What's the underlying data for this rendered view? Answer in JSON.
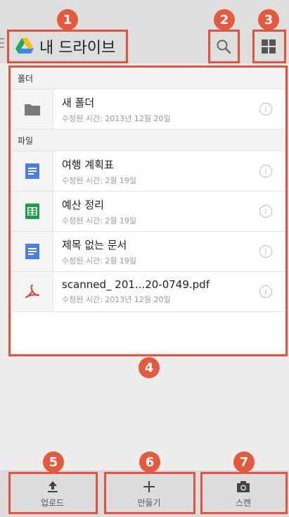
{
  "header": {
    "title": "내 드라이브"
  },
  "list": {
    "sections": [
      {
        "title": "폴더",
        "items": [
          {
            "name": "새 폴더",
            "meta": "수정된 시간: 2013년 12월 20일",
            "icon": "folder-icon"
          }
        ]
      },
      {
        "title": "파일",
        "items": [
          {
            "name": "여행 계획표",
            "meta": "수정된 시간: 2월 19일",
            "icon": "doc-icon"
          },
          {
            "name": "예산 정리",
            "meta": "수정된 시간: 2월 19일",
            "icon": "sheet-icon"
          },
          {
            "name": "제목 없는 문서",
            "meta": "수정된 시간: 2월 19일",
            "icon": "doc-icon"
          },
          {
            "name": "scanned_ 201...20-0749.pdf",
            "meta": "수정된 시간: 2013년 12월 20일",
            "icon": "pdf-icon"
          }
        ]
      }
    ],
    "info_glyph": "i"
  },
  "bottom": {
    "upload": "업로드",
    "create": "만들기",
    "scan": "스캔"
  },
  "callouts": [
    "1",
    "2",
    "3",
    "4",
    "5",
    "6",
    "7"
  ],
  "colors": {
    "callout": "#e0533d",
    "doc": "#4a7ee0",
    "sheet": "#1b9e48",
    "pdf": "#e0422d",
    "folder": "#7a7a7a"
  }
}
